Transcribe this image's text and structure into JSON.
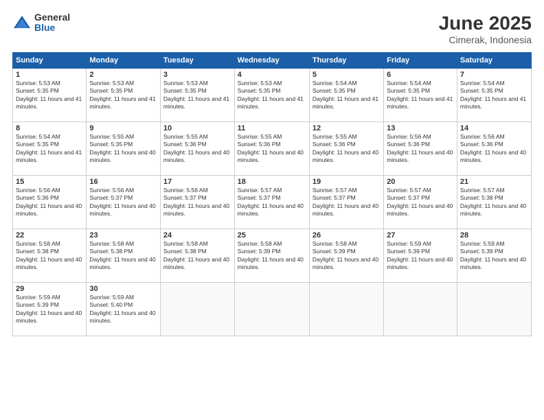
{
  "logo": {
    "general": "General",
    "blue": "Blue"
  },
  "title": "June 2025",
  "location": "Cimerak, Indonesia",
  "weekdays": [
    "Sunday",
    "Monday",
    "Tuesday",
    "Wednesday",
    "Thursday",
    "Friday",
    "Saturday"
  ],
  "days": [
    {
      "num": "1",
      "col": 0,
      "sunrise": "5:53 AM",
      "sunset": "5:35 PM",
      "daylight": "11 hours and 41 minutes."
    },
    {
      "num": "2",
      "col": 1,
      "sunrise": "5:53 AM",
      "sunset": "5:35 PM",
      "daylight": "11 hours and 41 minutes."
    },
    {
      "num": "3",
      "col": 2,
      "sunrise": "5:53 AM",
      "sunset": "5:35 PM",
      "daylight": "11 hours and 41 minutes."
    },
    {
      "num": "4",
      "col": 3,
      "sunrise": "5:53 AM",
      "sunset": "5:35 PM",
      "daylight": "11 hours and 41 minutes."
    },
    {
      "num": "5",
      "col": 4,
      "sunrise": "5:54 AM",
      "sunset": "5:35 PM",
      "daylight": "11 hours and 41 minutes."
    },
    {
      "num": "6",
      "col": 5,
      "sunrise": "5:54 AM",
      "sunset": "5:35 PM",
      "daylight": "11 hours and 41 minutes."
    },
    {
      "num": "7",
      "col": 6,
      "sunrise": "5:54 AM",
      "sunset": "5:35 PM",
      "daylight": "11 hours and 41 minutes."
    },
    {
      "num": "8",
      "col": 0,
      "sunrise": "5:54 AM",
      "sunset": "5:35 PM",
      "daylight": "11 hours and 41 minutes."
    },
    {
      "num": "9",
      "col": 1,
      "sunrise": "5:55 AM",
      "sunset": "5:35 PM",
      "daylight": "11 hours and 40 minutes."
    },
    {
      "num": "10",
      "col": 2,
      "sunrise": "5:55 AM",
      "sunset": "5:36 PM",
      "daylight": "11 hours and 40 minutes."
    },
    {
      "num": "11",
      "col": 3,
      "sunrise": "5:55 AM",
      "sunset": "5:36 PM",
      "daylight": "11 hours and 40 minutes."
    },
    {
      "num": "12",
      "col": 4,
      "sunrise": "5:55 AM",
      "sunset": "5:36 PM",
      "daylight": "11 hours and 40 minutes."
    },
    {
      "num": "13",
      "col": 5,
      "sunrise": "5:56 AM",
      "sunset": "5:36 PM",
      "daylight": "11 hours and 40 minutes."
    },
    {
      "num": "14",
      "col": 6,
      "sunrise": "5:56 AM",
      "sunset": "5:36 PM",
      "daylight": "11 hours and 40 minutes."
    },
    {
      "num": "15",
      "col": 0,
      "sunrise": "5:56 AM",
      "sunset": "5:36 PM",
      "daylight": "11 hours and 40 minutes."
    },
    {
      "num": "16",
      "col": 1,
      "sunrise": "5:56 AM",
      "sunset": "5:37 PM",
      "daylight": "11 hours and 40 minutes."
    },
    {
      "num": "17",
      "col": 2,
      "sunrise": "5:56 AM",
      "sunset": "5:37 PM",
      "daylight": "11 hours and 40 minutes."
    },
    {
      "num": "18",
      "col": 3,
      "sunrise": "5:57 AM",
      "sunset": "5:37 PM",
      "daylight": "11 hours and 40 minutes."
    },
    {
      "num": "19",
      "col": 4,
      "sunrise": "5:57 AM",
      "sunset": "5:37 PM",
      "daylight": "11 hours and 40 minutes."
    },
    {
      "num": "20",
      "col": 5,
      "sunrise": "5:57 AM",
      "sunset": "5:37 PM",
      "daylight": "11 hours and 40 minutes."
    },
    {
      "num": "21",
      "col": 6,
      "sunrise": "5:57 AM",
      "sunset": "5:38 PM",
      "daylight": "11 hours and 40 minutes."
    },
    {
      "num": "22",
      "col": 0,
      "sunrise": "5:58 AM",
      "sunset": "5:38 PM",
      "daylight": "11 hours and 40 minutes."
    },
    {
      "num": "23",
      "col": 1,
      "sunrise": "5:58 AM",
      "sunset": "5:38 PM",
      "daylight": "11 hours and 40 minutes."
    },
    {
      "num": "24",
      "col": 2,
      "sunrise": "5:58 AM",
      "sunset": "5:38 PM",
      "daylight": "11 hours and 40 minutes."
    },
    {
      "num": "25",
      "col": 3,
      "sunrise": "5:58 AM",
      "sunset": "5:39 PM",
      "daylight": "11 hours and 40 minutes."
    },
    {
      "num": "26",
      "col": 4,
      "sunrise": "5:58 AM",
      "sunset": "5:39 PM",
      "daylight": "11 hours and 40 minutes."
    },
    {
      "num": "27",
      "col": 5,
      "sunrise": "5:59 AM",
      "sunset": "5:39 PM",
      "daylight": "11 hours and 40 minutes."
    },
    {
      "num": "28",
      "col": 6,
      "sunrise": "5:59 AM",
      "sunset": "5:39 PM",
      "daylight": "11 hours and 40 minutes."
    },
    {
      "num": "29",
      "col": 0,
      "sunrise": "5:59 AM",
      "sunset": "5:39 PM",
      "daylight": "11 hours and 40 minutes."
    },
    {
      "num": "30",
      "col": 1,
      "sunrise": "5:59 AM",
      "sunset": "5:40 PM",
      "daylight": "11 hours and 40 minutes."
    }
  ]
}
